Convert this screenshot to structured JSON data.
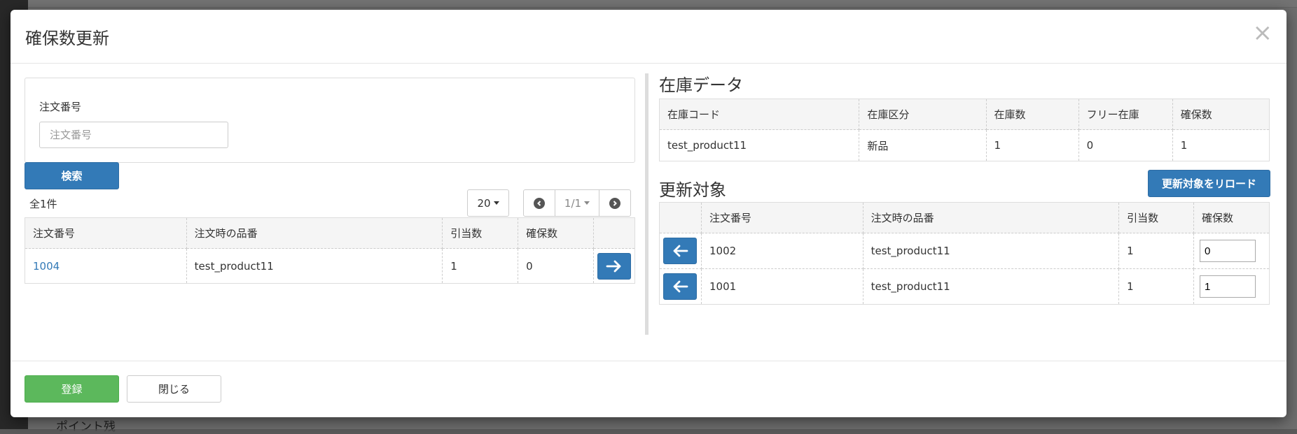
{
  "background": {
    "bottom_label": "ポイント残"
  },
  "modal": {
    "title": "確保数更新",
    "close_symbol": "×"
  },
  "search": {
    "order_label": "注文番号",
    "order_placeholder": "注文番号",
    "order_value": "",
    "button_label": "検索"
  },
  "results": {
    "total_text": "全1件",
    "per_page": "20",
    "page_indicator": "1/1",
    "headers": [
      "注文番号",
      "注文時の品番",
      "引当数",
      "確保数"
    ],
    "rows": [
      {
        "order_no": "1004",
        "item_code": "test_product11",
        "allocated": "1",
        "reserved": "0"
      }
    ]
  },
  "stock": {
    "title": "在庫データ",
    "headers": [
      "在庫コード",
      "在庫区分",
      "在庫数",
      "フリー在庫",
      "確保数"
    ],
    "rows": [
      {
        "code": "test_product11",
        "category": "新品",
        "qty": "1",
        "free": "0",
        "reserved": "1"
      }
    ]
  },
  "targets": {
    "title": "更新対象",
    "reload_label": "更新対象をリロード",
    "headers": [
      "注文番号",
      "注文時の品番",
      "引当数",
      "確保数"
    ],
    "rows": [
      {
        "order_no": "1002",
        "item_code": "test_product11",
        "allocated": "1",
        "reserved": "0"
      },
      {
        "order_no": "1001",
        "item_code": "test_product11",
        "allocated": "1",
        "reserved": "1"
      }
    ]
  },
  "footer": {
    "submit_label": "登録",
    "close_label": "閉じる"
  },
  "colors": {
    "primary": "#337ab7",
    "success": "#5cb85c",
    "link": "#337ab7"
  },
  "icons": {
    "add_arrow": "arrow-right-icon",
    "remove_arrow": "arrow-left-icon",
    "prev_page": "chevron-left-circle-icon",
    "next_page": "chevron-right-circle-icon",
    "close": "close-icon"
  }
}
